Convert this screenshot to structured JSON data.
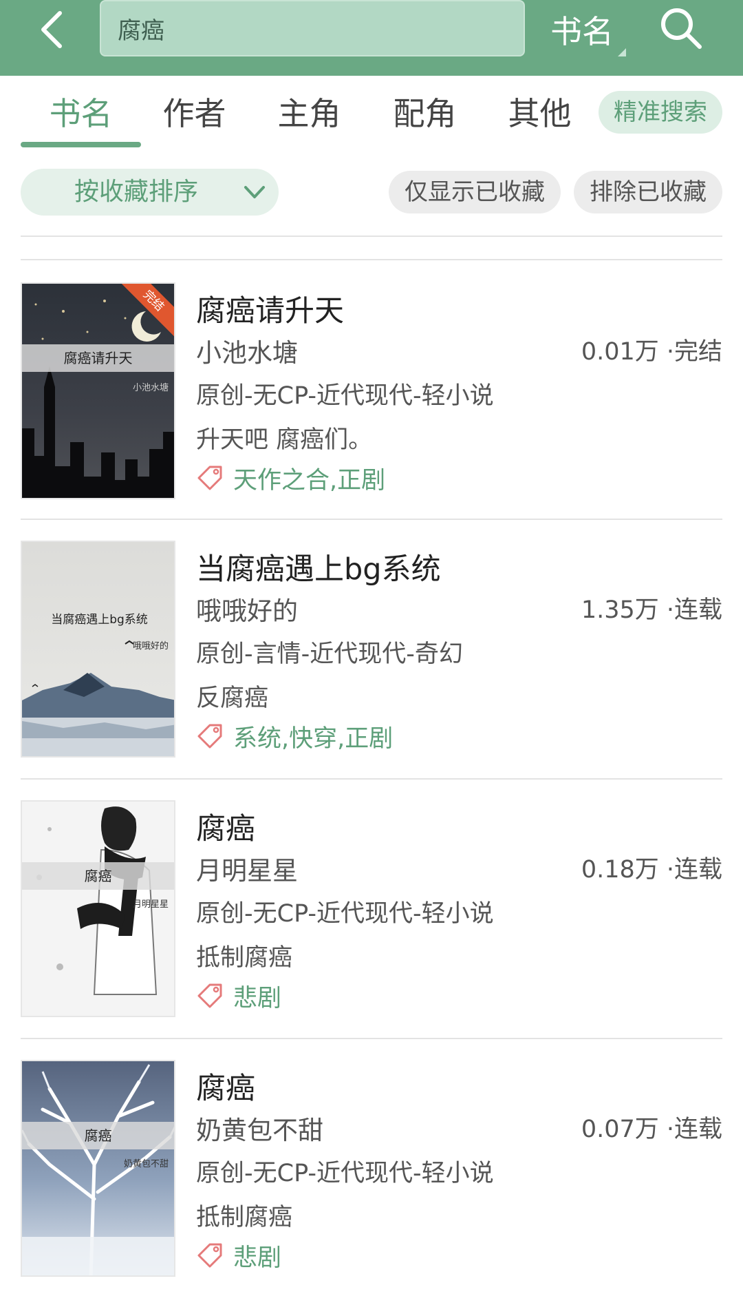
{
  "header": {
    "query": "腐癌",
    "search_type": "书名",
    "bg_color": "#6aa984"
  },
  "tabs": [
    {
      "label": "书名",
      "active": true
    },
    {
      "label": "作者",
      "active": false
    },
    {
      "label": "主角",
      "active": false
    },
    {
      "label": "配角",
      "active": false
    },
    {
      "label": "其他",
      "active": false
    }
  ],
  "precise_search_label": "精准搜索",
  "filters": {
    "sort_label": "按收藏排序",
    "show_only_collected": "仅显示已收藏",
    "exclude_collected": "排除已收藏"
  },
  "books": [
    {
      "title": "腐癌请升天",
      "author": "小池水塘",
      "stats": "0.01万 ·完结",
      "genre": "原创-无CP-近代现代-轻小说",
      "intro": "升天吧 腐癌们。",
      "tags": "天作之合,正剧",
      "cover_title": "腐癌请升天",
      "cover_author": "小池水塘",
      "cover_badge": "完结"
    },
    {
      "title": "当腐癌遇上bg系统",
      "author": "哦哦好的",
      "stats": "1.35万 ·连载",
      "genre": "原创-言情-近代现代-奇幻",
      "intro": "反腐癌",
      "tags": "系统,快穿,正剧",
      "cover_title": "当腐癌遇上bg系统",
      "cover_author": "哦哦好的"
    },
    {
      "title": "腐癌",
      "author": "月明星星",
      "stats": "0.18万 ·连载",
      "genre": "原创-无CP-近代现代-轻小说",
      "intro": "抵制腐癌",
      "tags": "悲剧",
      "cover_title": "腐癌",
      "cover_author": "月明星星"
    },
    {
      "title": "腐癌",
      "author": "奶黄包不甜",
      "stats": "0.07万 ·连载",
      "genre": "原创-无CP-近代现代-轻小说",
      "intro": "抵制腐癌",
      "tags": "悲剧",
      "cover_title": "腐癌",
      "cover_author": "奶黄包不甜"
    }
  ]
}
